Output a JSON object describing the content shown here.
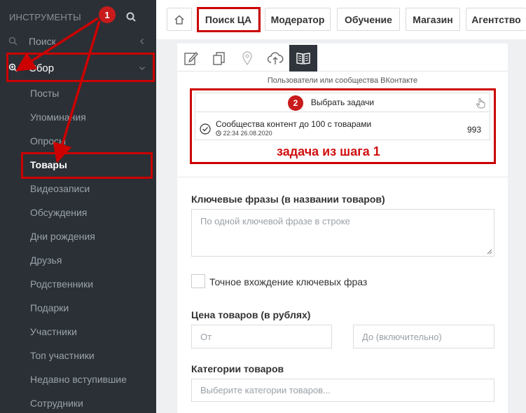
{
  "sidebar": {
    "header": "ИНСТРУМЕНТЫ",
    "items": [
      {
        "label": "Поиск"
      },
      {
        "label": "Сбор"
      },
      {
        "label": "Посты"
      },
      {
        "label": "Упоминания"
      },
      {
        "label": "Опросы"
      },
      {
        "label": "Товары"
      },
      {
        "label": "Видеозаписи"
      },
      {
        "label": "Обсуждения"
      },
      {
        "label": "Дни рождения"
      },
      {
        "label": "Друзья"
      },
      {
        "label": "Родственники"
      },
      {
        "label": "Подарки"
      },
      {
        "label": "Участники"
      },
      {
        "label": "Топ участники"
      },
      {
        "label": "Недавно вступившие"
      },
      {
        "label": "Сотрудники"
      }
    ]
  },
  "tabs": [
    {
      "label": "Поиск ЦА"
    },
    {
      "label": "Модератор"
    },
    {
      "label": "Обучение"
    },
    {
      "label": "Магазин"
    },
    {
      "label": "Агентство"
    }
  ],
  "main": {
    "caption": "Пользователи или сообщества ВКонтакте",
    "select_tasks": "Выбрать задачи",
    "task": {
      "title": "Сообщества контент до 100 с товарами",
      "date": "22:34 26.08.2020",
      "count": "993"
    },
    "keywords_label": "Ключевые фразы (в названии товаров)",
    "keywords_placeholder": "По одной ключевой фразе в строке",
    "exact_match_label": "Точное вхождение ключевых фраз",
    "price_label": "Цена товаров (в рублях)",
    "price_from_placeholder": "От",
    "price_to_placeholder": "До (включительно)",
    "categories_label": "Категории товаров",
    "categories_placeholder": "Выберите категории товаров..."
  },
  "annotations": {
    "badge1": "1",
    "badge2": "2",
    "step_text": "задача из шага 1",
    "color": "#cc0000"
  },
  "colors": {
    "sidebar_bg": "#2b3036",
    "toolbar_active": "#2f353b",
    "annotation_red": "#cc0000"
  }
}
